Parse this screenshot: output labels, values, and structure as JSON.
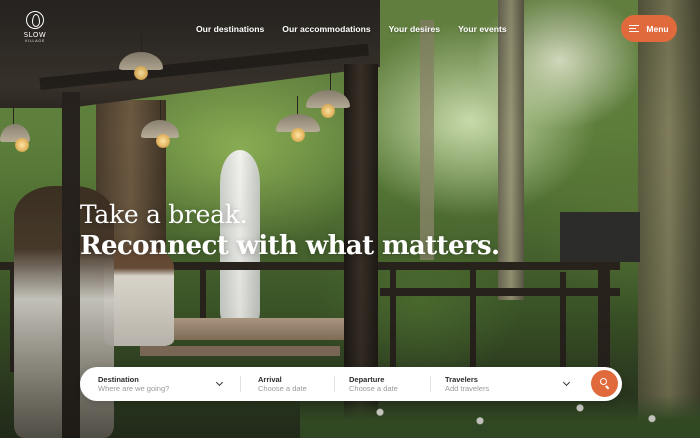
{
  "brand": {
    "name": "SLOW",
    "tagline": "VILLAGE"
  },
  "nav": {
    "items": [
      {
        "label": "Our destinations"
      },
      {
        "label": "Our accommodations"
      },
      {
        "label": "Your desires"
      },
      {
        "label": "Your events"
      }
    ],
    "menu_label": "Menu"
  },
  "hero": {
    "line1": "Take a break.",
    "line2": "Reconnect with what matters."
  },
  "search": {
    "destination": {
      "label": "Destination",
      "placeholder": "Where are we going?"
    },
    "arrival": {
      "label": "Arrival",
      "placeholder": "Choose a date"
    },
    "departure": {
      "label": "Departure",
      "placeholder": "Choose a date"
    },
    "travelers": {
      "label": "Travelers",
      "placeholder": "Add travelers"
    }
  },
  "icons": {
    "logo": "leaf-logo-icon",
    "menu": "hamburger-menu-icon",
    "dropdown": "chevron-down-icon",
    "search": "search-icon"
  },
  "colors": {
    "accent": "#e06a3c",
    "text_light": "#ffffff",
    "text_dark": "#2b2b2b",
    "placeholder": "#9a9a9a"
  }
}
